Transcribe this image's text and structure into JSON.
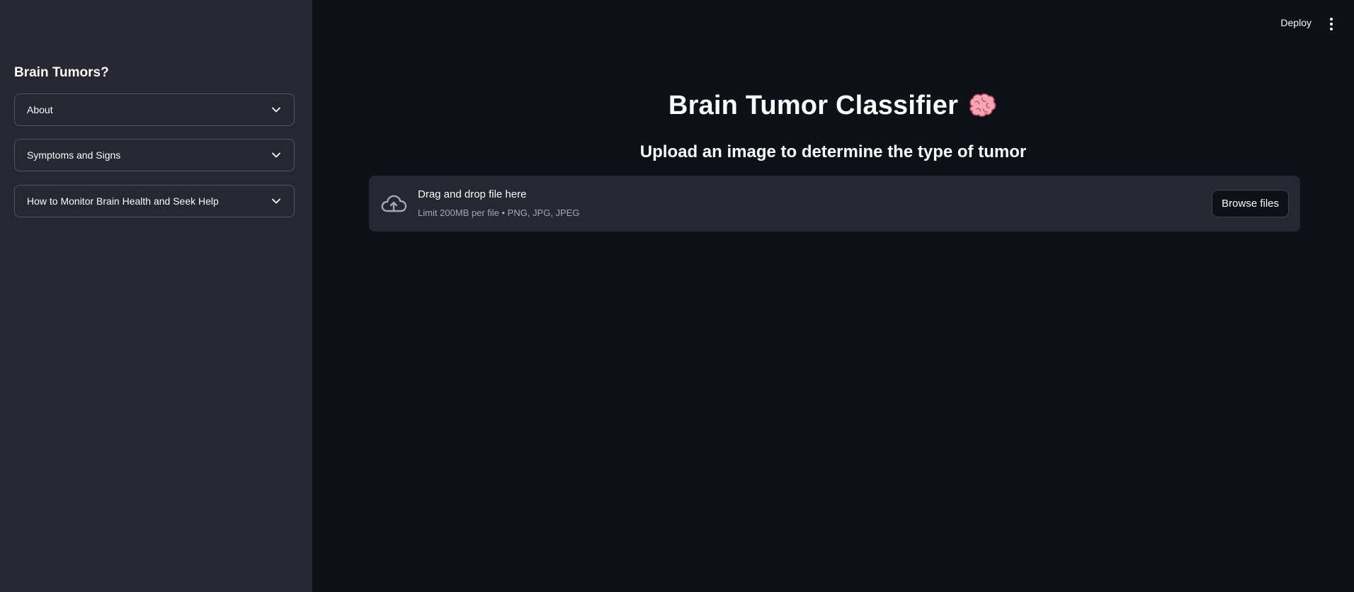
{
  "sidebar": {
    "title": "Brain Tumors?",
    "expanders": [
      {
        "label": "About"
      },
      {
        "label": "Symptoms and Signs"
      },
      {
        "label": "How to Monitor Brain Health and Seek Help"
      }
    ]
  },
  "header": {
    "deploy_label": "Deploy",
    "menu_icon": "kebab-menu-icon"
  },
  "main": {
    "title": "Brain Tumor Classifier",
    "title_icon": "brain-emoji-icon",
    "subtitle": "Upload an image to determine the type of tumor"
  },
  "uploader": {
    "icon": "cloud-upload-icon",
    "drop_text": "Drag and drop file here",
    "limit_text": "Limit 200MB per file • PNG, JPG, JPEG",
    "browse_label": "Browse files"
  },
  "colors": {
    "background": "#0e1117",
    "sidebar": "#262730",
    "text": "#fafafa",
    "muted_text": "#a3a8b8"
  }
}
